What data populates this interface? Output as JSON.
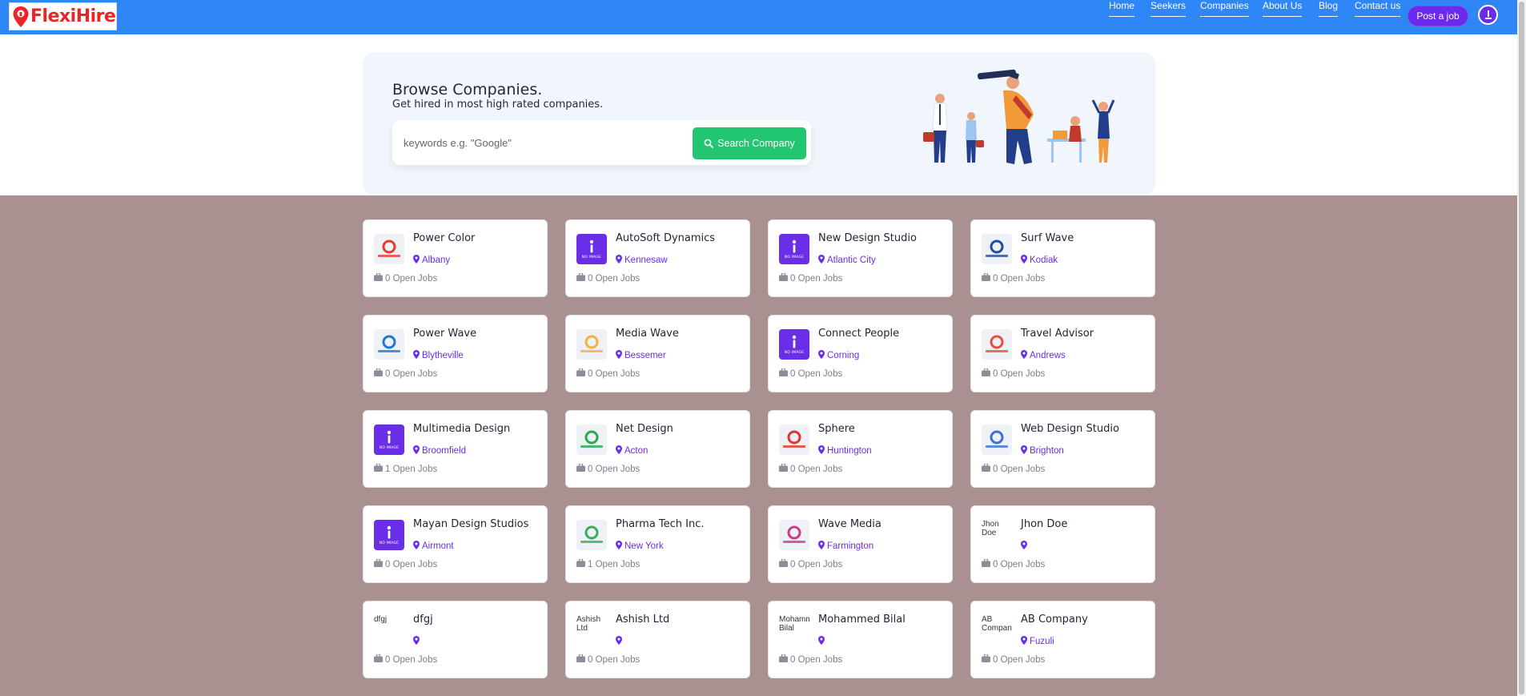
{
  "header": {
    "logo_text": "FlexiHire",
    "nav": [
      {
        "label": "Home"
      },
      {
        "label": "Seekers"
      },
      {
        "label": "Companies"
      },
      {
        "label": "About Us"
      },
      {
        "label": "Blog"
      },
      {
        "label": "Contact us"
      }
    ],
    "post_job_label": "Post a job"
  },
  "hero": {
    "title": "Browse Companies.",
    "subtitle": "Get hired in most high rated companies.",
    "search_placeholder": "keywords e.g. \"Google\"",
    "search_button_label": "Search Company"
  },
  "companies": [
    {
      "name": "Power Color",
      "location": "Albany",
      "jobs": "0 Open Jobs",
      "logo": "logo",
      "logo_text": "PowerColor",
      "logo_color": "#e63b2e"
    },
    {
      "name": "AutoSoft Dynamics",
      "location": "Kennesaw",
      "jobs": "0 Open Jobs",
      "logo": "noimg"
    },
    {
      "name": "New Design Studio",
      "location": "Atlantic City",
      "jobs": "0 Open Jobs",
      "logo": "noimg"
    },
    {
      "name": "Surf Wave",
      "location": "Kodiak",
      "jobs": "0 Open Jobs",
      "logo": "logo",
      "logo_text": "SURF WAVE",
      "logo_color": "#1f4fa0"
    },
    {
      "name": "Power Wave",
      "location": "Blytheville",
      "jobs": "0 Open Jobs",
      "logo": "logo",
      "logo_text": "POWERWAVE",
      "logo_color": "#2177d1"
    },
    {
      "name": "Media Wave",
      "location": "Bessemer",
      "jobs": "0 Open Jobs",
      "logo": "logo",
      "logo_text": "MediaWave",
      "logo_color": "#f2b33a"
    },
    {
      "name": "Connect People",
      "location": "Corning",
      "jobs": "0 Open Jobs",
      "logo": "noimg"
    },
    {
      "name": "Travel Advisor",
      "location": "Andrews",
      "jobs": "0 Open Jobs",
      "logo": "logo",
      "logo_text": "TravelAdvisor",
      "logo_color": "#e94e3c"
    },
    {
      "name": "Multimedia Design",
      "location": "Broomfield",
      "jobs": "1 Open Jobs",
      "logo": "noimg"
    },
    {
      "name": "Net Design",
      "location": "Acton",
      "jobs": "0 Open Jobs",
      "logo": "logo",
      "logo_text": "netdesign",
      "logo_color": "#2aa84a"
    },
    {
      "name": "Sphere",
      "location": "Huntington",
      "jobs": "0 Open Jobs",
      "logo": "logo",
      "logo_text": "sphere",
      "logo_color": "#e0352b"
    },
    {
      "name": "Web Design Studio",
      "location": "Brighton",
      "jobs": "0 Open Jobs",
      "logo": "logo",
      "logo_text": "WEB STUDIO",
      "logo_color": "#3a6fd8"
    },
    {
      "name": "Mayan Design Studios",
      "location": "Airmont",
      "jobs": "0 Open Jobs",
      "logo": "noimg"
    },
    {
      "name": "Pharma Tech Inc.",
      "location": "New York",
      "jobs": "1 Open Jobs",
      "logo": "logo",
      "logo_text": "PharmaTech",
      "logo_color": "#3cae5a"
    },
    {
      "name": "Wave Media",
      "location": "Farmington",
      "jobs": "0 Open Jobs",
      "logo": "logo",
      "logo_text": "wavemedia",
      "logo_color": "#c83c8a"
    },
    {
      "name": "Jhon Doe",
      "location": "",
      "jobs": "0 Open Jobs",
      "logo": "broken",
      "logo_alt": "Jhon Doe"
    },
    {
      "name": "dfgj",
      "location": "",
      "jobs": "0 Open Jobs",
      "logo": "broken",
      "logo_alt": "dfgj"
    },
    {
      "name": "Ashish Ltd",
      "location": "",
      "jobs": "0 Open Jobs",
      "logo": "broken",
      "logo_alt": "Ashish Ltd"
    },
    {
      "name": "Mohammed Bilal",
      "location": "",
      "jobs": "0 Open Jobs",
      "logo": "broken",
      "logo_alt": "Mohammed Bilal"
    },
    {
      "name": "AB Company",
      "location": "Fuzuli",
      "jobs": "0 Open Jobs",
      "logo": "broken",
      "logo_alt": "AB Company"
    }
  ]
}
